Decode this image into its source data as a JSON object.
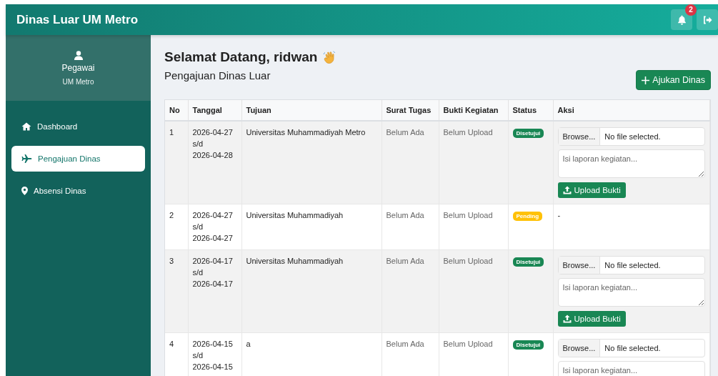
{
  "app_title": "Dinas Luar UM Metro",
  "notifications": {
    "count": "2"
  },
  "profile": {
    "role": "Pegawai",
    "org": "UM Metro"
  },
  "sidebar": {
    "items": [
      {
        "label": "Dashboard",
        "kind": "home",
        "selected": false
      },
      {
        "label": "Pengajuan Dinas",
        "kind": "travel",
        "selected": true
      },
      {
        "label": "Absensi Dinas",
        "kind": "attendance",
        "selected": false
      }
    ]
  },
  "greeting": "Selamat Datang, ridwan",
  "section_title": "Pengajuan Dinas Luar",
  "add_button": "Ajukan Dinas",
  "table": {
    "columns": [
      "No",
      "Tanggal",
      "Tujuan",
      "Surat Tugas",
      "Bukti Kegiatan",
      "Status",
      "Aksi"
    ],
    "rows": [
      {
        "no": "1",
        "start": "2026-04-27",
        "sep": "s/d",
        "end": "2026-04-28",
        "tujuan": "Universitas Muhammadiyah Metro",
        "surat": "Belum Ada",
        "bukti": "Belum Upload",
        "status": {
          "label": "Disetujui",
          "kind": "approved"
        },
        "action": {
          "kind": "upload",
          "browse": "Browse...",
          "file": "No file selected.",
          "placeholder": "Isi laporan kegiatan...",
          "button": "Upload Bukti"
        }
      },
      {
        "no": "2",
        "start": "2026-04-27",
        "sep": "s/d",
        "end": "2026-04-27",
        "tujuan": "Universitas Muhammadiyah",
        "surat": "Belum Ada",
        "bukti": "Belum Upload",
        "status": {
          "label": "Pending",
          "kind": "pending"
        },
        "action": {
          "kind": "none",
          "text": "-"
        }
      },
      {
        "no": "3",
        "start": "2026-04-17",
        "sep": "s/d",
        "end": "2026-04-17",
        "tujuan": "Universitas Muhammadiyah",
        "surat": "Belum Ada",
        "bukti": "Belum Upload",
        "status": {
          "label": "Disetujui",
          "kind": "approved"
        },
        "action": {
          "kind": "upload",
          "browse": "Browse...",
          "file": "No file selected.",
          "placeholder": "Isi laporan kegiatan...",
          "button": "Upload Bukti"
        }
      },
      {
        "no": "4",
        "start": "2026-04-15",
        "sep": "s/d",
        "end": "2026-04-15",
        "tujuan": "a",
        "surat": "Belum Ada",
        "bukti": "Belum Upload",
        "status": {
          "label": "Disetujui",
          "kind": "approved"
        },
        "action": {
          "kind": "upload",
          "browse": "Browse...",
          "file": "No file selected.",
          "placeholder": "Isi laporan kegiatan..."
        }
      }
    ]
  }
}
